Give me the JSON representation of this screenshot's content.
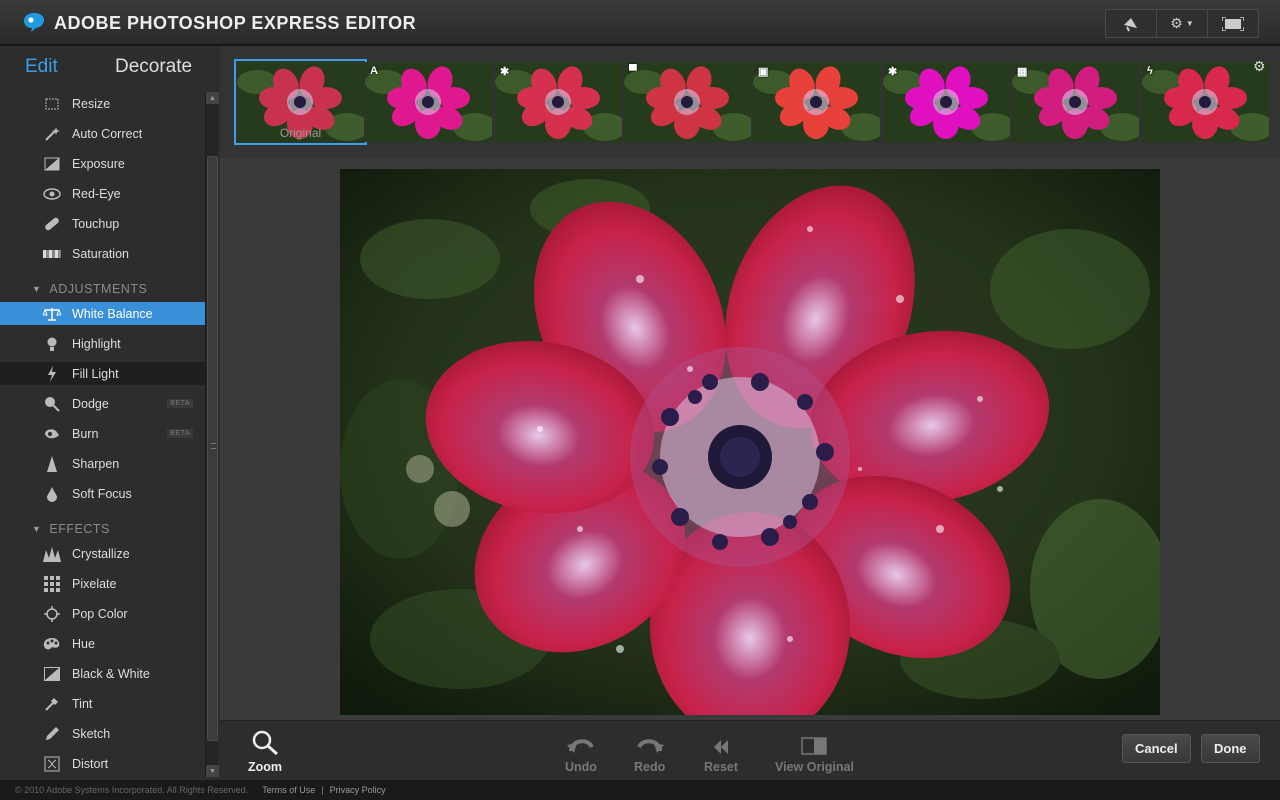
{
  "app": {
    "title": "ADOBE PHOTOSHOP EXPRESS EDITOR"
  },
  "titlebar_buttons": [
    {
      "name": "megaphone-icon"
    },
    {
      "name": "gear-dropdown-icon"
    },
    {
      "name": "fullscreen-icon"
    }
  ],
  "modes": {
    "edit": "Edit",
    "decorate": "Decorate"
  },
  "tools_basic": [
    {
      "label": "Resize",
      "icon": "resize-icon"
    },
    {
      "label": "Auto Correct",
      "icon": "wand-icon"
    },
    {
      "label": "Exposure",
      "icon": "exposure-icon"
    },
    {
      "label": "Red-Eye",
      "icon": "eye-icon"
    },
    {
      "label": "Touchup",
      "icon": "bandage-icon"
    },
    {
      "label": "Saturation",
      "icon": "saturation-icon"
    }
  ],
  "adjustments": {
    "heading": "ADJUSTMENTS",
    "items": [
      {
        "label": "White Balance",
        "icon": "scales-icon"
      },
      {
        "label": "Highlight",
        "icon": "bulb-icon"
      },
      {
        "label": "Fill Light",
        "icon": "bolt-icon"
      },
      {
        "label": "Dodge",
        "icon": "dodge-icon",
        "badge": "BETA"
      },
      {
        "label": "Burn",
        "icon": "burn-icon",
        "badge": "BETA"
      },
      {
        "label": "Sharpen",
        "icon": "sharpen-icon"
      },
      {
        "label": "Soft Focus",
        "icon": "drop-icon"
      }
    ]
  },
  "effects": {
    "heading": "EFFECTS",
    "items": [
      {
        "label": "Crystallize",
        "icon": "crystal-icon"
      },
      {
        "label": "Pixelate",
        "icon": "pixel-icon"
      },
      {
        "label": "Pop Color",
        "icon": "target-icon"
      },
      {
        "label": "Hue",
        "icon": "palette-icon"
      },
      {
        "label": "Black & White",
        "icon": "bw-icon"
      },
      {
        "label": "Tint",
        "icon": "dropper-icon"
      },
      {
        "label": "Sketch",
        "icon": "pencil-icon"
      },
      {
        "label": "Distort",
        "icon": "distort-icon"
      }
    ]
  },
  "thumbnails": [
    {
      "label": "Original",
      "tint": "#c8324f",
      "badge": ""
    },
    {
      "label": "",
      "tint": "#e0188f",
      "badge": "A"
    },
    {
      "label": "",
      "tint": "#d6304f",
      "badge": "✱"
    },
    {
      "label": "",
      "tint": "#cf3444",
      "badge": "▀"
    },
    {
      "label": "",
      "tint": "#e8403a",
      "badge": "▣"
    },
    {
      "label": "",
      "tint": "#e010c0",
      "badge": "✱"
    },
    {
      "label": "",
      "tint": "#d21c80",
      "badge": "▦"
    },
    {
      "label": "",
      "tint": "#d8284c",
      "badge": "ϟ"
    }
  ],
  "bottom": {
    "zoom": "Zoom",
    "undo": "Undo",
    "redo": "Redo",
    "reset": "Reset",
    "view_original": "View Original",
    "cancel": "Cancel",
    "done": "Done"
  },
  "footer": {
    "copyright": "© 2010 Adobe Systems Incorporated. All Rights Reserved.",
    "terms": "Terms of Use",
    "privacy": "Privacy Policy"
  },
  "colors": {
    "accent": "#3b9fe6",
    "selected_row": "#3a8fd9"
  }
}
